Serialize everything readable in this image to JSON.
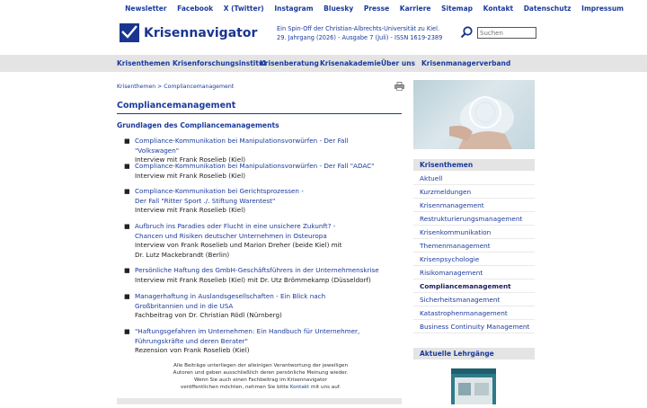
{
  "toplinks": [
    "Newsletter",
    "Facebook",
    "X (Twitter)",
    "Instagram",
    "Bluesky",
    "Presse",
    "Karriere",
    "Sitemap",
    "Kontakt",
    "Datenschutz",
    "Impressum"
  ],
  "brand": {
    "name": "Krisennavigator"
  },
  "tagline": {
    "line1": "Ein Spin-Off der Christian-Albrechts-Universität zu Kiel.",
    "line2": "29. Jahrgang (2026) - Ausgabe 7 (Juli) - ISSN 1619-2389"
  },
  "search": {
    "placeholder": "Suchen"
  },
  "nav": [
    "Krisenthemen",
    "Krisenforschungsinstitut",
    "Krisenberatung",
    "Krisenakademie",
    "Über uns",
    "Krisenmanagerverband"
  ],
  "breadcrumb": "Krisenthemen > Compliancemanagement",
  "page_title": "Compliancemanagement",
  "subheading": "Grundlagen des Compliancemanagements",
  "articles": [
    {
      "line1": "Compliance-Kommunikation bei Manipulationsvorwürfen - Der Fall \"Volkswagen\"",
      "line2": "",
      "desc1": "Interview mit Frank Roselieb (Kiel)",
      "desc2": ""
    },
    {
      "line1": "Compliance-Kommunikation bei Manipulationsvorwürfen - Der Fall \"ADAC\"",
      "line2": "",
      "desc1": "Interview mit Frank Roselieb (Kiel)",
      "desc2": ""
    },
    {
      "line1": "Compliance-Kommunikation bei Gerichtsprozessen -",
      "line2": "Der Fall \"Ritter Sport ./. Stiftung Warentest\"",
      "desc1": "Interview mit Frank Roselieb (Kiel)",
      "desc2": ""
    },
    {
      "line1": "Aufbruch ins Paradies oder Flucht in eine unsichere Zukunft? -",
      "line2": "Chancen und Risiken deutscher Unternehmen in Osteuropa",
      "desc1": "Interview von Frank Roselieb und Marion Dreher (beide Kiel) mit",
      "desc2": "Dr. Lutz Mackebrandt (Berlin)"
    },
    {
      "line1": "Persönliche Haftung des GmbH-Geschäftsführers in der Unternehmenskrise",
      "line2": "",
      "desc1": "Interview mit Frank Roselieb (Kiel) mit Dr. Utz Brömmekamp (Düsseldorf)",
      "desc2": ""
    },
    {
      "line1": "Managerhaftung in Auslandsgesellschaften - Ein Blick nach",
      "line2": "Großbritannien und in die USA",
      "desc1": "Fachbeitrag von Dr. Christian Rödl (Nürnberg)",
      "desc2": ""
    },
    {
      "line1": "\"Haftungsgefahren im Unternehmen: Ein Handbuch für Unternehmer,",
      "line2": "Führungskräfte und deren Berater\"",
      "desc1": "Rezension von Frank Roselieb (Kiel)",
      "desc2": ""
    }
  ],
  "footnote": {
    "line1": "Alle Beiträge unterliegen der alleinigen Verantwortung der jeweiligen",
    "line2": "Autoren und geben ausschließlich deren persönliche Meinung wieder.",
    "line3": "Wenn Sie auch einen Fachbeitrag im Krisennavigator",
    "line4_pre": "veröffentlichen möchten, nehmen Sie bitte",
    "line4_link": "Kontakt",
    "line4_post": "mit uns auf."
  },
  "sidebar": {
    "heading": "Krisenthemen",
    "items": [
      "Aktuell",
      "Kurzmeldungen",
      "Krisenmanagement",
      "Restrukturierungsmanagement",
      "Krisenkommunikation",
      "Themenmanagement",
      "Krisenpsychologie",
      "Risikomanagement",
      "Compliancemanagement",
      "Sicherheitsmanagement",
      "Katastrophenmanagement",
      "Business Continuity Management"
    ],
    "active_index": 8,
    "heading2": "Aktuelle Lehrgänge"
  },
  "colors": {
    "brand": "#1a3590",
    "link": "#1a3a9c",
    "nav_bg": "#e4e4e4"
  }
}
